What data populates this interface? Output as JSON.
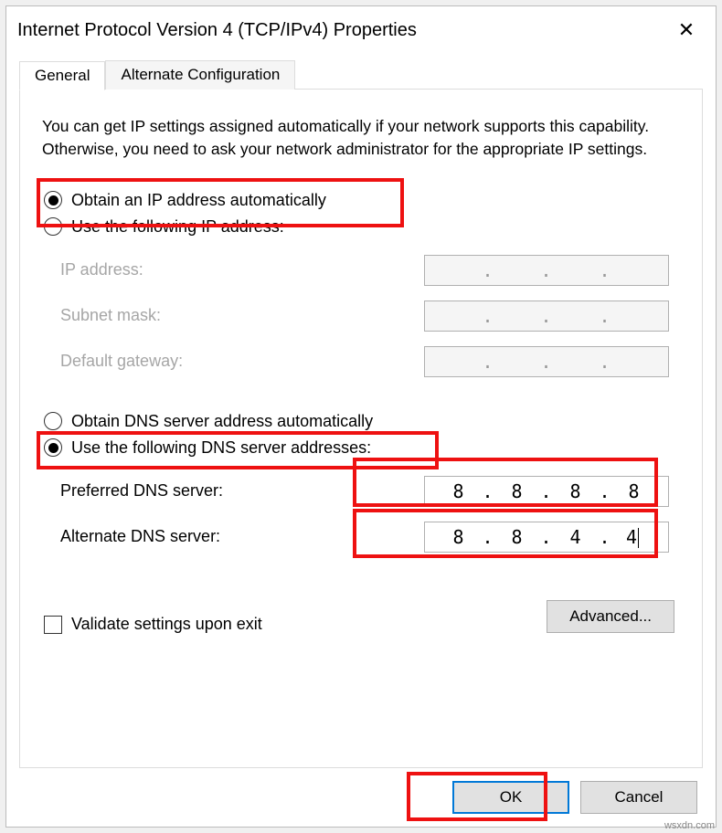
{
  "window": {
    "title": "Internet Protocol Version 4 (TCP/IPv4) Properties"
  },
  "tabs": {
    "general": "General",
    "alt": "Alternate Configuration"
  },
  "description": "You can get IP settings assigned automatically if your network supports this capability. Otherwise, you need to ask your network administrator for the appropriate IP settings.",
  "ip": {
    "auto": "Obtain an IP address automatically",
    "manual": "Use the following IP address:",
    "ip_label": "IP address:",
    "subnet_label": "Subnet mask:",
    "gateway_label": "Default gateway:"
  },
  "dns": {
    "auto": "Obtain DNS server address automatically",
    "manual": "Use the following DNS server addresses:",
    "preferred_label": "Preferred DNS server:",
    "alternate_label": "Alternate DNS server:",
    "preferred_value": {
      "a": "8",
      "b": "8",
      "c": "8",
      "d": "8"
    },
    "alternate_value": {
      "a": "8",
      "b": "8",
      "c": "4",
      "d": "4"
    }
  },
  "validate_label": "Validate settings upon exit",
  "buttons": {
    "advanced": "Advanced...",
    "ok": "OK",
    "cancel": "Cancel"
  },
  "watermark": "wsxdn.com"
}
